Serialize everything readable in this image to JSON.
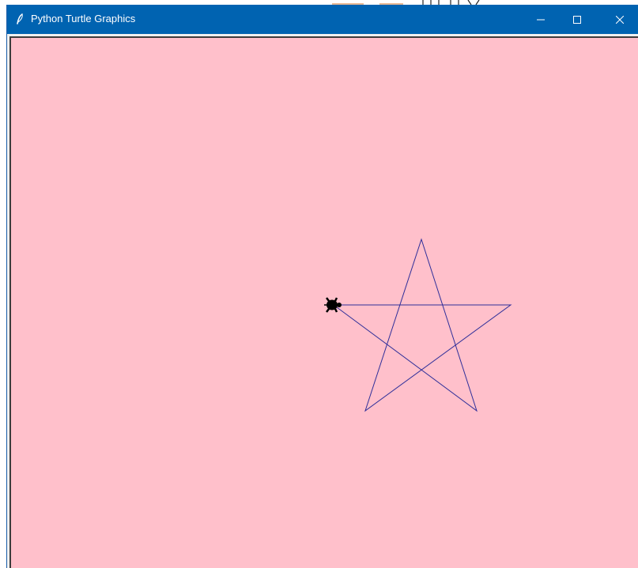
{
  "window": {
    "title": "Python Turtle Graphics",
    "titlebar_color": "#0063b1",
    "controls": {
      "minimize_icon": "minimize-icon",
      "maximize_icon": "maximize-icon",
      "close_icon": "close-icon"
    },
    "app_icon": "feather-icon"
  },
  "canvas": {
    "background_color": "#ffc0cb",
    "pen_color": "#2f2f9a",
    "turtle_color": "#000000",
    "shape": "star",
    "turtle_shape": "turtle"
  }
}
